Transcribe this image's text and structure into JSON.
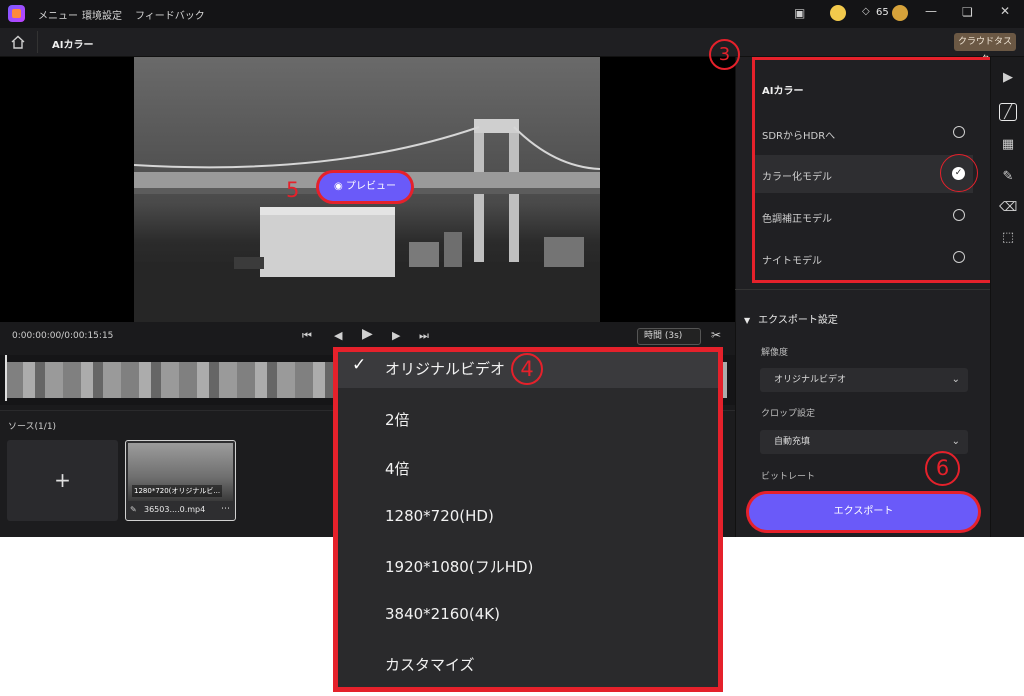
{
  "titlebar": {
    "menu": [
      "メニュー",
      "環境設定",
      "フィードバック"
    ],
    "credits": "65"
  },
  "toolbar": {
    "title": "AIカラー",
    "cloud_task": "クラウドタスク"
  },
  "preview": {
    "button_label": "プレビュー",
    "callout": "5"
  },
  "playback": {
    "timecode": "0:00:00:00/0:00:15:15",
    "duration_select": "時間 (3s)"
  },
  "source": {
    "title": "ソース(1/1)",
    "clip_resolution": "1280*720(オリジナルビ...",
    "clip_name": "36503....0.mp4"
  },
  "ai_panel": {
    "callout": "3",
    "heading": "AIカラー",
    "options": [
      {
        "label": "SDRからHDRへ",
        "selected": false
      },
      {
        "label": "カラー化モデル",
        "selected": true
      },
      {
        "label": "色調補正モデル",
        "selected": false
      },
      {
        "label": "ナイトモデル",
        "selected": false
      }
    ]
  },
  "export_settings": {
    "title": "エクスポート設定",
    "resolution_label": "解像度",
    "resolution_value": "オリジナルビデオ",
    "crop_label": "クロップ設定",
    "crop_value": "自動充填",
    "bitrate_label": "ビットレート",
    "export_button": "エクスポート",
    "callout": "6"
  },
  "dropdown": {
    "callout": "4",
    "items": [
      "オリジナルビデオ",
      "2倍",
      "4倍",
      "1280*720(HD)",
      "1920*1080(フルHD)",
      "3840*2160(4K)",
      "カスタマイズ"
    ],
    "selected_index": 0
  },
  "colors": {
    "accent": "#6a5af9",
    "annotation_red": "#e5212b",
    "background": "#1a1a1c"
  }
}
